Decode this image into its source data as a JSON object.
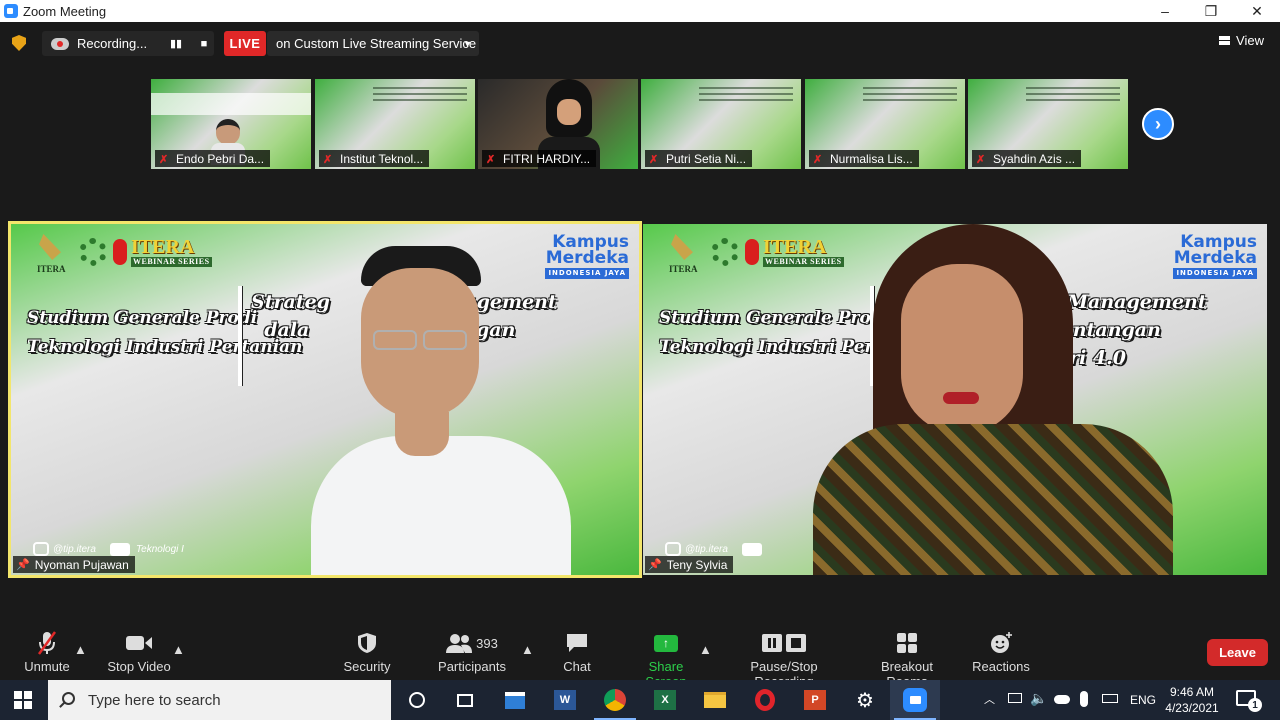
{
  "window": {
    "title": "Zoom Meeting",
    "controls": [
      "–",
      "❐",
      "✕"
    ]
  },
  "meeting_bar": {
    "recording_label": "Recording...",
    "live_label": "LIVE",
    "stream_service": "on Custom Live Streaming Service",
    "view_label": "View"
  },
  "thumbnails": [
    {
      "name": "Endo Pebri Da..."
    },
    {
      "name": "Institut Teknol..."
    },
    {
      "name": "FITRI HARDIY..."
    },
    {
      "name": "Putri Setia Ni..."
    },
    {
      "name": "Nurmalisa Lis..."
    },
    {
      "name": "Syahdin Azis ..."
    }
  ],
  "slide": {
    "itera": "ITERA",
    "webinar_brand": "ITERA",
    "webinar_sub": "WEBINAR SERIES",
    "kampus_line1": "Kampus",
    "kampus_line2": "Merdeka",
    "kampus_sub": "INDONESIA JAYA",
    "studium_line1": "Studium Generale Prodi",
    "studium_line2": "Teknologi Industri Pertanian",
    "left_title": "Strateg         in Management\n  dala          pi Tantangan\n                    stri 4.0",
    "right_title": "St              Chain Management\n                 dapi Tantangan\n                   ndustri 4.0",
    "social_left": "@tip.itera",
    "social_left_yt": "Teknologi I",
    "social_right": "@tip.itera"
  },
  "speakers": [
    {
      "name": "Nyoman Pujawan"
    },
    {
      "name": "Teny Sylvia"
    }
  ],
  "toolbar": {
    "unmute": "Unmute",
    "stop_video": "Stop Video",
    "security": "Security",
    "participants": "Participants",
    "participant_count": "393",
    "chat": "Chat",
    "share_screen": "Share Screen",
    "pause_recording": "Pause/Stop Recording",
    "breakout": "Breakout Rooms",
    "reactions": "Reactions",
    "leave": "Leave"
  },
  "taskbar": {
    "search_placeholder": "Type here to search",
    "language": "ENG",
    "time": "9:46 AM",
    "date": "4/23/2021",
    "notification_count": "1"
  }
}
